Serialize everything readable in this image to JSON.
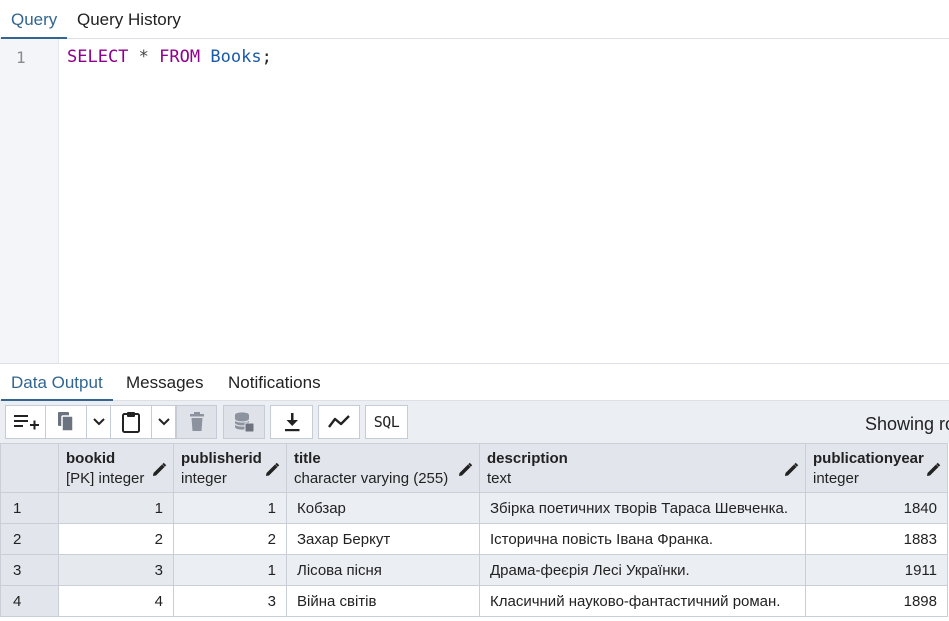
{
  "query_tabs": [
    {
      "label": "Query",
      "active": true
    },
    {
      "label": "Query History",
      "active": false
    }
  ],
  "editor": {
    "line_number": "1",
    "tokens": {
      "select": "SELECT",
      "star": "*",
      "from": "FROM",
      "table": "Books",
      "semicolon": ";"
    }
  },
  "result_tabs": [
    {
      "label": "Data Output",
      "active": true
    },
    {
      "label": "Messages",
      "active": false
    },
    {
      "label": "Notifications",
      "active": false
    }
  ],
  "toolbar": {
    "buttons": [
      "add-row",
      "copy",
      "copy-options",
      "paste",
      "paste-options",
      "delete",
      "save-data",
      "download",
      "graph",
      "sql"
    ],
    "sql_label": "SQL",
    "showing_text": "Showing ro"
  },
  "grid": {
    "columns": [
      {
        "name": "bookid",
        "type": "[PK] integer"
      },
      {
        "name": "publisherid",
        "type": "integer"
      },
      {
        "name": "title",
        "type": "character varying (255)"
      },
      {
        "name": "description",
        "type": "text"
      },
      {
        "name": "publicationyear",
        "type": "integer"
      }
    ],
    "rows": [
      {
        "n": "1",
        "bookid": "1",
        "publisherid": "1",
        "title": "Кобзар",
        "description": "Збірка поетичних творів Тараса Шевченка.",
        "publicationyear": "1840"
      },
      {
        "n": "2",
        "bookid": "2",
        "publisherid": "2",
        "title": "Захар Беркут",
        "description": "Історична повість Івана Франка.",
        "publicationyear": "1883"
      },
      {
        "n": "3",
        "bookid": "3",
        "publisherid": "1",
        "title": "Лісова пісня",
        "description": "Драма-феєрія Лесі Українки.",
        "publicationyear": "1911"
      },
      {
        "n": "4",
        "bookid": "4",
        "publisherid": "3",
        "title": "Війна світів",
        "description": "Класичний науково-фантастичний роман.",
        "publicationyear": "1898"
      }
    ]
  },
  "colors": {
    "accent": "#326690",
    "keyword": "#8e008e",
    "identifier": "#1a5aa6"
  }
}
